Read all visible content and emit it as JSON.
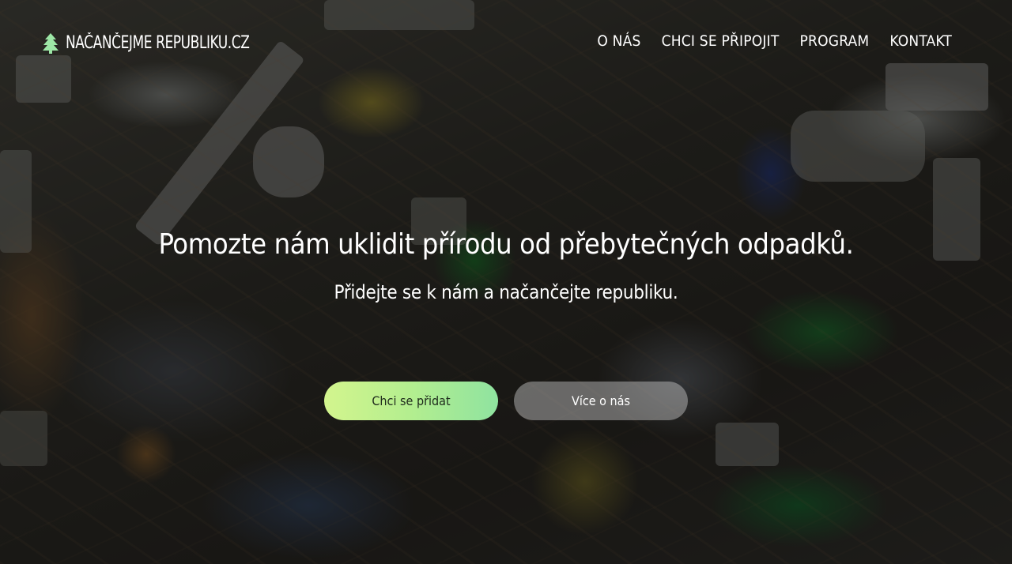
{
  "brand": {
    "name": "NAČANČEJME REPUBLIKU.CZ",
    "icon": "tree-icon",
    "icon_color": "#9de7a6"
  },
  "nav": {
    "items": [
      {
        "label": "O NÁS"
      },
      {
        "label": "CHCI SE PŘIPOJIT"
      },
      {
        "label": "PROGRAM"
      },
      {
        "label": "KONTAKT"
      }
    ]
  },
  "hero": {
    "headline": "Pomozte nám uklidit přírodu od přebytečných odpadků.",
    "subline": "Přidejte se k nám a načančejte republiku.",
    "primary_button": "Chci se přidat",
    "secondary_button": "Více o nás",
    "background": "beach-litter-photo"
  },
  "colors": {
    "primary_gradient_start": "#d3f58e",
    "primary_gradient_end": "#8fe3a0",
    "secondary_button_bg": "rgba(205,205,205,0.45)",
    "text": "#ffffff"
  }
}
